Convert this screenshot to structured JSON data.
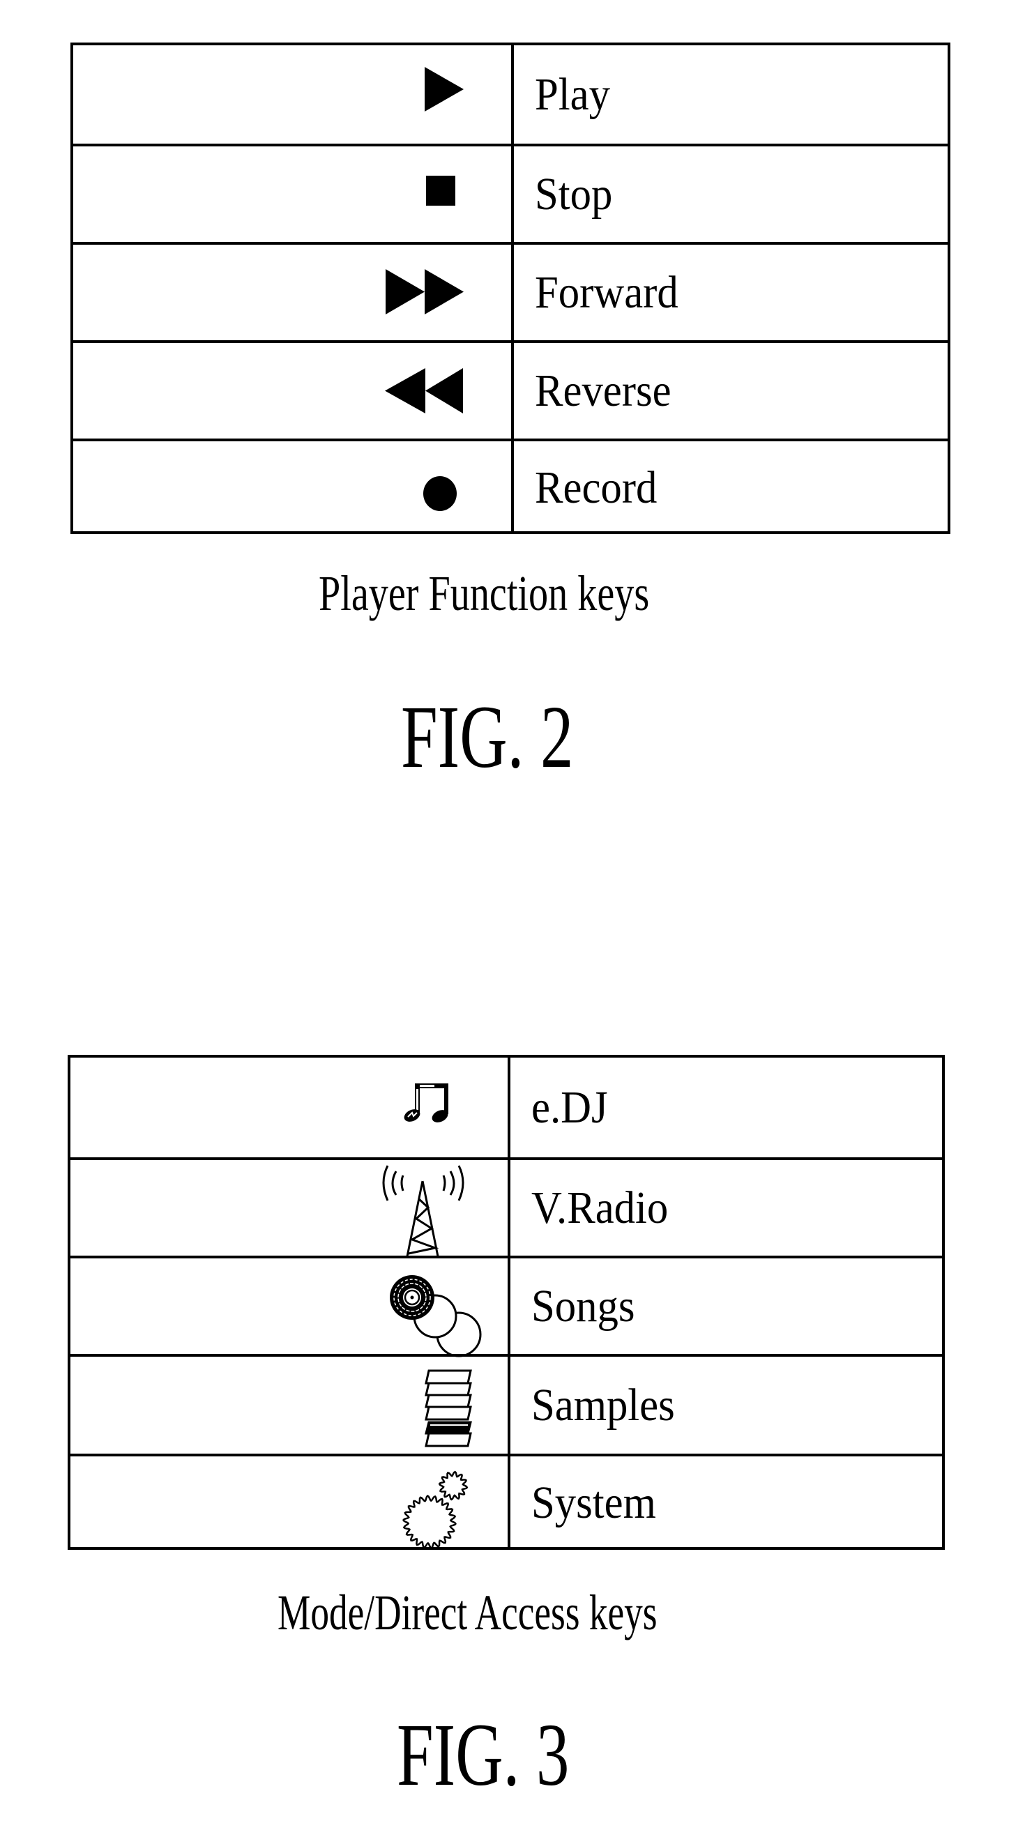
{
  "figures": [
    {
      "id": "fig2",
      "caption": "Player Function keys",
      "figure_label": "FIG. 2",
      "rows": [
        {
          "icon": "play-icon",
          "label": "Play"
        },
        {
          "icon": "stop-icon",
          "label": "Stop"
        },
        {
          "icon": "fast-forward-icon",
          "label": "Forward"
        },
        {
          "icon": "rewind-icon",
          "label": "Reverse"
        },
        {
          "icon": "record-icon",
          "label": "Record"
        }
      ]
    },
    {
      "id": "fig3",
      "caption": "Mode/Direct Access keys",
      "figure_label": "FIG. 3",
      "rows": [
        {
          "icon": "music-note-icon",
          "label": "e.DJ"
        },
        {
          "icon": "radio-tower-icon",
          "label": "V.Radio"
        },
        {
          "icon": "discs-icon",
          "label": "Songs"
        },
        {
          "icon": "stacked-samples-icon",
          "label": "Samples"
        },
        {
          "icon": "gears-icon",
          "label": "System"
        }
      ]
    }
  ]
}
